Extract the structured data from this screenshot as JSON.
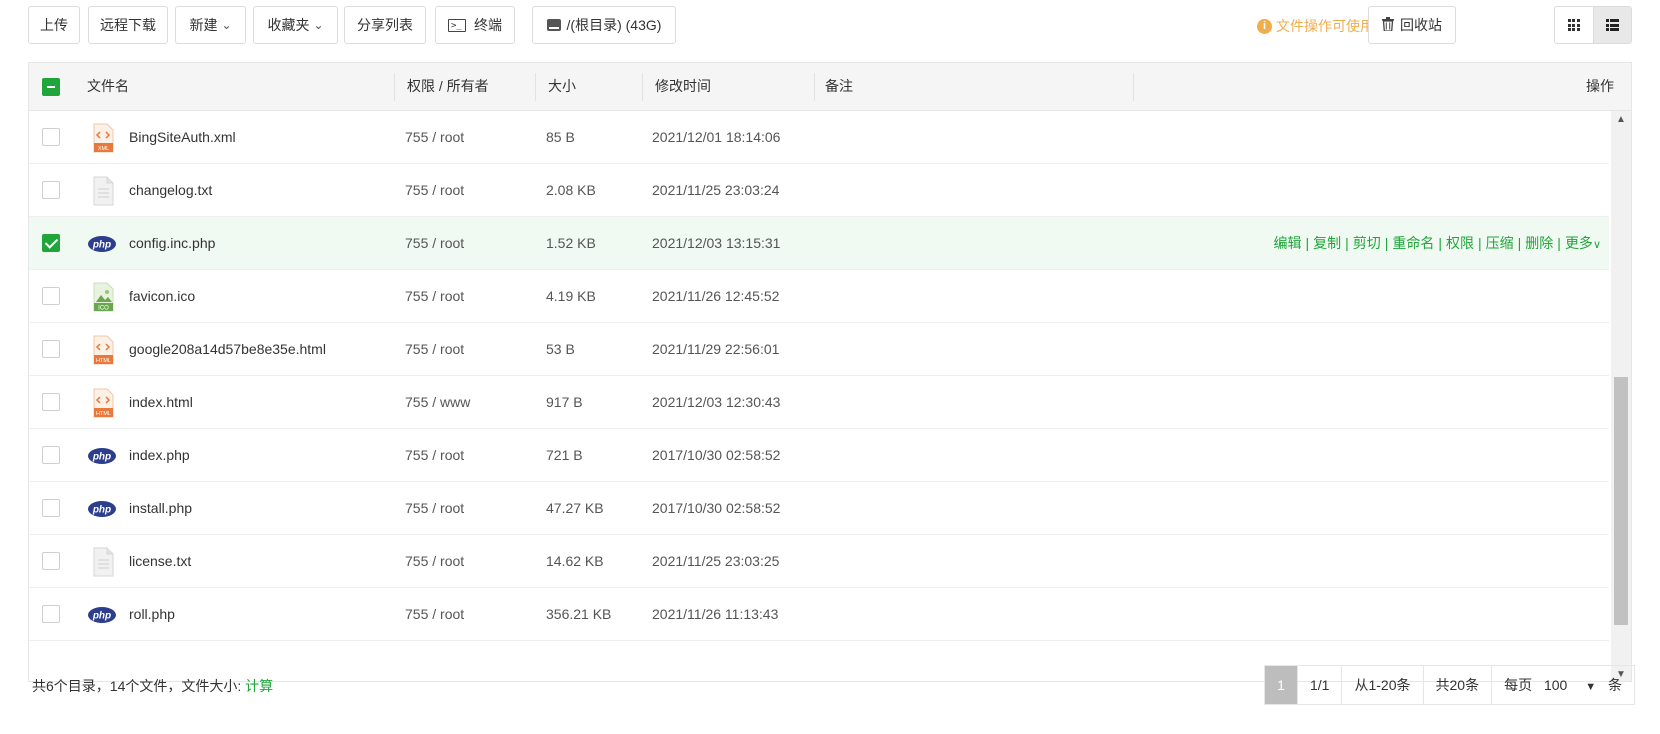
{
  "toolbar": {
    "upload": "上传",
    "remote_download": "远程下载",
    "new": "新建",
    "favorites": "收藏夹",
    "share_list": "分享列表",
    "terminal": "终端",
    "terminal_glyph": ">_",
    "disk": "/(根目录) (43G)",
    "hint": "文件操作可使用右键",
    "recycle_bin": "回收站",
    "info_glyph": "i"
  },
  "table": {
    "headers": {
      "name": "文件名",
      "perm": "权限 / 所有者",
      "size": "大小",
      "mtime": "修改时间",
      "note": "备注",
      "ops": "操作"
    },
    "rows": [
      {
        "name": "BingSiteAuth.xml",
        "type": "xml",
        "perm": "755 / root",
        "size": "85 B",
        "mtime": "2021/12/01 18:14:06"
      },
      {
        "name": "changelog.txt",
        "type": "txt",
        "perm": "755 / root",
        "size": "2.08 KB",
        "mtime": "2021/11/25 23:03:24"
      },
      {
        "name": "config.inc.php",
        "type": "php",
        "perm": "755 / root",
        "size": "1.52 KB",
        "mtime": "2021/12/03 13:15:31",
        "selected": true
      },
      {
        "name": "favicon.ico",
        "type": "ico",
        "perm": "755 / root",
        "size": "4.19 KB",
        "mtime": "2021/11/26 12:45:52"
      },
      {
        "name": "google208a14d57be8e35e.html",
        "type": "html",
        "perm": "755 / root",
        "size": "53 B",
        "mtime": "2021/11/29 22:56:01"
      },
      {
        "name": "index.html",
        "type": "html",
        "perm": "755 / www",
        "size": "917 B",
        "mtime": "2021/12/03 12:30:43"
      },
      {
        "name": "index.php",
        "type": "php",
        "perm": "755 / root",
        "size": "721 B",
        "mtime": "2017/10/30 02:58:52"
      },
      {
        "name": "install.php",
        "type": "php",
        "perm": "755 / root",
        "size": "47.27 KB",
        "mtime": "2017/10/30 02:58:52"
      },
      {
        "name": "license.txt",
        "type": "txt",
        "perm": "755 / root",
        "size": "14.62 KB",
        "mtime": "2021/11/25 23:03:25"
      },
      {
        "name": "roll.php",
        "type": "php",
        "perm": "755 / root",
        "size": "356.21 KB",
        "mtime": "2021/11/26 11:13:43"
      }
    ],
    "row_actions": [
      "编辑",
      "复制",
      "剪切",
      "重命名",
      "权限",
      "压缩",
      "删除",
      "更多"
    ],
    "icon_labels": {
      "xml": "XML",
      "html": "HTML",
      "php": "php",
      "ico": "ICO"
    }
  },
  "footer": {
    "summary": "共6个目录，14个文件，文件大小: ",
    "calc_link": "计算"
  },
  "pager": {
    "current": "1",
    "pages": "1/1",
    "range": "从1-20条",
    "total": "共20条",
    "per_page_label": "每页",
    "per_page_value": "100",
    "per_page_unit": "条"
  },
  "colors": {
    "accent": "#20a53a",
    "hint": "#f0ad4e",
    "php_badge": "#2d3e8c",
    "doc_orange": "#e8793a"
  }
}
